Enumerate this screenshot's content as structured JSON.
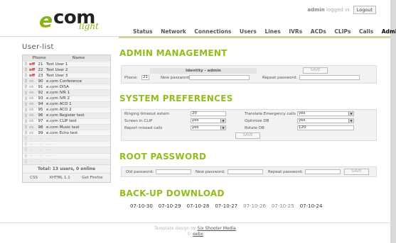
{
  "logo": {
    "e": "e",
    "com": "com",
    "light": "light"
  },
  "user": {
    "name": "admin",
    "suffix": "logged in",
    "logout": "Logout"
  },
  "nav": [
    "Status",
    "Network",
    "Connections",
    "Users",
    "Lines",
    "IVRs",
    "ACDs",
    "CLIPs",
    "Calls",
    "Admin"
  ],
  "sidebar": {
    "title": "User-list",
    "col_phone": "Phone",
    "col_name": "Name",
    "rows": [
      {
        "status": "off",
        "num": "21",
        "name": "Test User 1"
      },
      {
        "status": "off",
        "num": "22",
        "name": "Test User 2"
      },
      {
        "status": "off",
        "num": "23",
        "name": "Test User 3"
      },
      {
        "status": "ok",
        "num": "90",
        "name": "e.com Conference"
      },
      {
        "status": "ok",
        "num": "91",
        "name": "e.com DISA"
      },
      {
        "status": "ok",
        "num": "92",
        "name": "e.com IVR 1"
      },
      {
        "status": "ok",
        "num": "93",
        "name": "e.com IVR 2"
      },
      {
        "status": "ok",
        "num": "94",
        "name": "e.com ACD 1"
      },
      {
        "status": "ok",
        "num": "95",
        "name": "e.com ACD 2"
      },
      {
        "status": "ok",
        "num": "96",
        "name": "e.com Register test"
      },
      {
        "status": "ok",
        "num": "97",
        "name": "e.com CLIP test"
      },
      {
        "status": "ok",
        "num": "98",
        "name": "e.com Music test"
      },
      {
        "status": "ok",
        "num": "99",
        "name": "e.com Echo test"
      },
      {
        "status": "--",
        "num": "--",
        "name": "----"
      },
      {
        "status": "--",
        "num": "--",
        "name": "----"
      },
      {
        "status": "--",
        "num": "--",
        "name": "----"
      },
      {
        "status": "--",
        "num": "--",
        "name": "----"
      },
      {
        "status": "--",
        "num": "--",
        "name": "----"
      }
    ],
    "total": "Total: 13 users, 0 online",
    "badges": [
      "CSS",
      "XHTML 1.1",
      "Get Firefox"
    ]
  },
  "admin": {
    "heading": "ADMIN MANAGEMENT",
    "identity": "Identity - admin",
    "save": "SAVE",
    "phone_label": "Phone:",
    "phone_value": "21",
    "new_pw_label": "New password:",
    "repeat_pw_label": "Repeat password:"
  },
  "prefs": {
    "heading": "SYSTEM PREFERENCES",
    "ringing_label": "Ringing timeout extern",
    "ringing_value": "20",
    "emergency_label": "Translate Emergency calls",
    "emergency_value": "yes",
    "screen_label": "Screen in CLIP",
    "screen_value": "yes",
    "optimize_label": "Optimize DB",
    "optimize_value": "yes",
    "missed_label": "Report missed calls",
    "missed_value": "yes",
    "rotate_label": "Rotate DB",
    "rotate_value": "120",
    "save": "SAVE"
  },
  "root": {
    "heading": "ROOT PASSWORD",
    "old_label": "Old password:",
    "new_label": "New password:",
    "repeat_label": "Repeat password:",
    "save": "SAVE"
  },
  "backup": {
    "heading": "BACK-UP DOWNLOAD",
    "dates": [
      {
        "d": "07-10-30",
        "gray": false
      },
      {
        "d": "07-10-29",
        "gray": false
      },
      {
        "d": "07-10-28",
        "gray": false
      },
      {
        "d": "07-10-27",
        "gray": false
      },
      {
        "d": "07-10-26",
        "gray": true
      },
      {
        "d": "07-10-25",
        "gray": true
      },
      {
        "d": "07-10-24",
        "gray": false
      }
    ]
  },
  "footer": {
    "line1": "Template design by",
    "link1": "Six Shooter Media",
    "line2": "©",
    "link2": "eebx"
  },
  "colors": {
    "accent": "#93bd1c",
    "off": "#d02020"
  }
}
